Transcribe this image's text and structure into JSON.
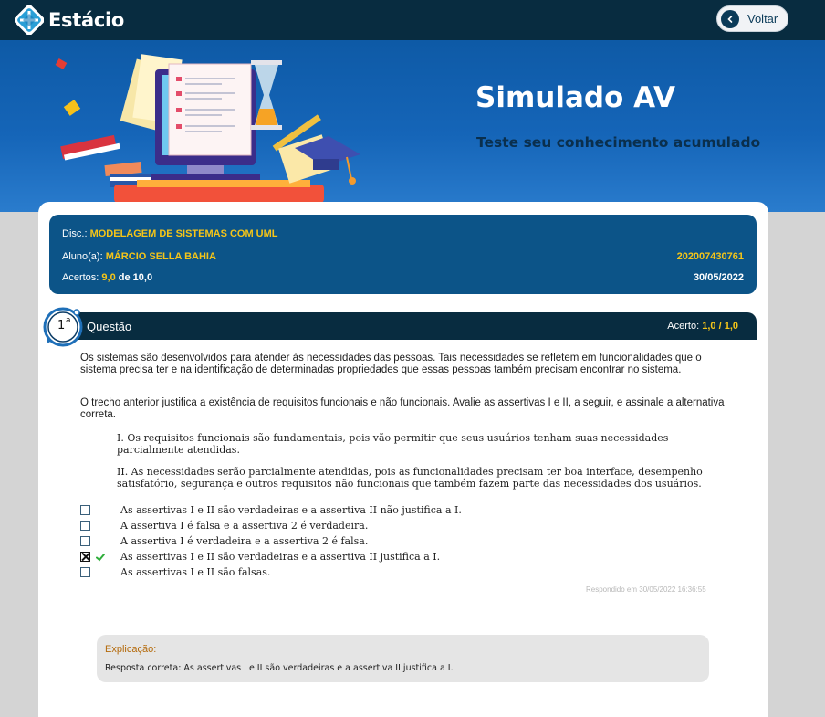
{
  "header": {
    "brand": "Estácio",
    "back_label": "Voltar"
  },
  "banner": {
    "title": "Simulado AV",
    "subtitle": "Teste seu conhecimento acumulado"
  },
  "info": {
    "disc_label": "Disc.:",
    "disc_value": "MODELAGEM DE SISTEMAS COM UML",
    "aluno_label": "Aluno(a):",
    "aluno_value": "MÁRCIO SELLA BAHIA",
    "matricula": "202007430761",
    "acertos_label": "Acertos:",
    "acertos_value": "9,0",
    "acertos_total": "de 10,0",
    "date": "30/05/2022"
  },
  "question": {
    "number": "1",
    "number_sup": "a",
    "label": "Questão",
    "acerto_label": "Acerto:",
    "acerto_value": "1,0",
    "acerto_sep": "/",
    "acerto_total": "1,0",
    "paragraph1": "Os sistemas são desenvolvidos para atender às necessidades das pessoas. Tais necessidades se refletem em funcionalidades que o sistema precisa ter e na identificação de determinadas propriedades que essas pessoas também precisam encontrar no sistema.",
    "paragraph2": "O trecho anterior justifica a existência de requisitos funcionais e não funcionais. Avalie as assertivas I e II, a seguir, e assinale a alternativa correta.",
    "assertion1": "I. Os requisitos funcionais são fundamentais, pois vão permitir que seus usuários tenham suas necessidades parcialmente atendidas.",
    "assertion2": "II. As necessidades serão parcialmente atendidas, pois as funcionalidades precisam ter boa interface, desempenho satisfatório, segurança e outros requisitos não funcionais que também fazem parte das necessidades dos usuários.",
    "options": [
      {
        "label": "As assertivas I e II são verdadeiras e a assertiva II não justifica a I.",
        "checked": false
      },
      {
        "label": "A assertiva I é falsa e a assertiva 2 é verdadeira.",
        "checked": false
      },
      {
        "label": "A assertiva I é verdadeira e a assertiva 2 é falsa.",
        "checked": false
      },
      {
        "label": "As assertivas I e II são verdadeiras e a assertiva II justifica a I.",
        "checked": true
      },
      {
        "label": "As assertivas I e II são falsas.",
        "checked": false
      }
    ],
    "answered_text": "Respondido em 30/05/2022 16:36:55"
  },
  "explanation": {
    "title": "Explicação:",
    "text": "Resposta correta: As assertivas I e II são verdadeiras e a assertiva II justifica a I."
  },
  "colors": {
    "header_bg": "#082c40",
    "info_bg": "#0c5488",
    "highlight": "#f5c518",
    "explanation_title": "#b46a0b"
  }
}
